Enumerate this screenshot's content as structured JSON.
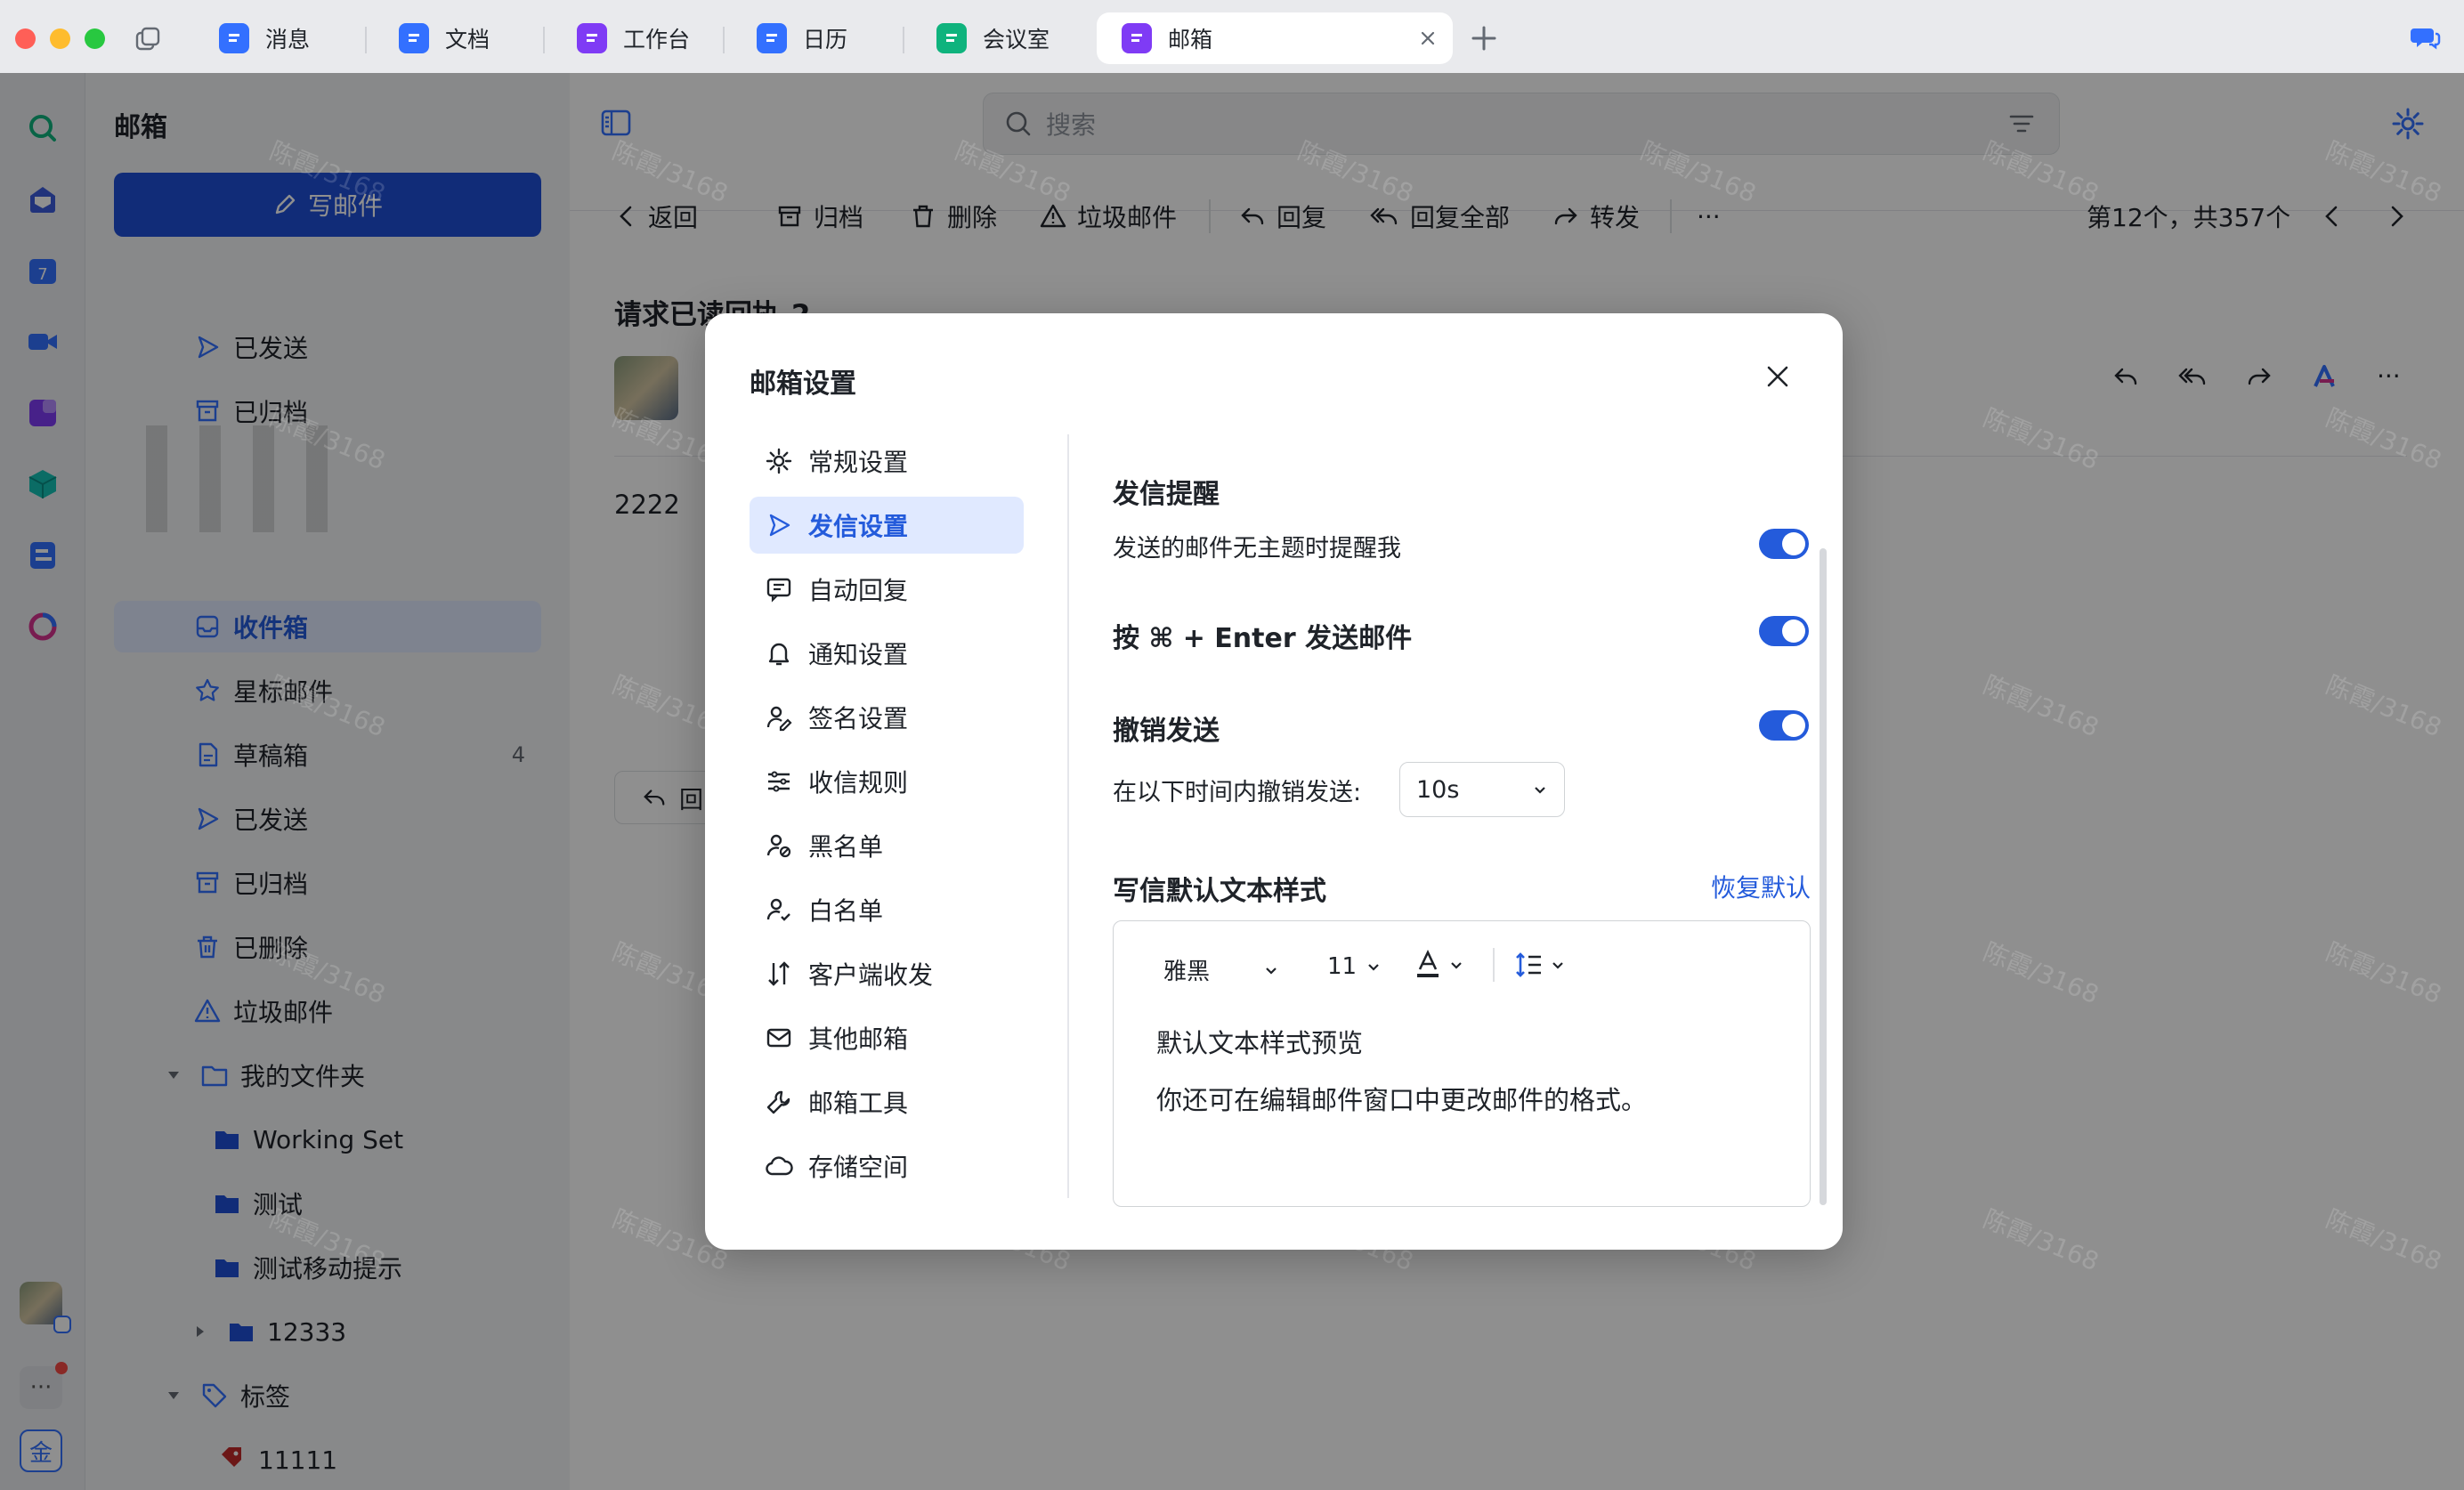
{
  "tabs": [
    {
      "label": "消息",
      "icon": "chat-icon"
    },
    {
      "label": "文档",
      "icon": "doc-icon"
    },
    {
      "label": "工作台",
      "icon": "workbench-icon"
    },
    {
      "label": "日历",
      "icon": "calendar-icon"
    },
    {
      "label": "会议室",
      "icon": "meeting-room-icon"
    },
    {
      "label": "邮箱",
      "icon": "mail-icon"
    }
  ],
  "sidebar": {
    "title": "邮箱",
    "compose": "写邮件",
    "items_a": [
      "已发送",
      "已归档"
    ],
    "items_b": [
      {
        "label": "收件箱",
        "icon": "inbox-icon",
        "active": true
      },
      {
        "label": "星标邮件",
        "icon": "star-icon"
      },
      {
        "label": "草稿箱",
        "icon": "draft-icon",
        "count": "4"
      },
      {
        "label": "已发送",
        "icon": "send-icon"
      },
      {
        "label": "已归档",
        "icon": "archive-icon"
      },
      {
        "label": "已删除",
        "icon": "trash-icon"
      },
      {
        "label": "垃圾邮件",
        "icon": "warning-icon"
      }
    ],
    "folders_title": "我的文件夹",
    "folders": [
      "Working Set",
      "测试",
      "测试移动提示",
      "12333"
    ],
    "tags_title": "标签",
    "tags": [
      "11111"
    ]
  },
  "main": {
    "search_placeholder": "搜索",
    "toolbar": {
      "back": "返回",
      "archive": "归档",
      "delete": "删除",
      "spam": "垃圾邮件",
      "reply": "回复",
      "reply_all": "回复全部",
      "forward": "转发",
      "more": "···",
      "position": "第12个，共357个"
    },
    "subject": "请求已读回执-2",
    "body": "2222",
    "reply_button": "回"
  },
  "watermark": "陈霞/3168",
  "modal": {
    "title": "邮箱设置",
    "nav": [
      {
        "label": "常规设置",
        "icon": "gear-icon"
      },
      {
        "label": "发信设置",
        "icon": "send-icon",
        "active": true
      },
      {
        "label": "自动回复",
        "icon": "auto-reply-icon"
      },
      {
        "label": "通知设置",
        "icon": "bell-icon"
      },
      {
        "label": "签名设置",
        "icon": "signature-icon"
      },
      {
        "label": "收信规则",
        "icon": "rules-icon"
      },
      {
        "label": "黑名单",
        "icon": "blacklist-icon"
      },
      {
        "label": "白名单",
        "icon": "whitelist-icon"
      },
      {
        "label": "客户端收发",
        "icon": "client-icon"
      },
      {
        "label": "其他邮箱",
        "icon": "other-mail-icon"
      },
      {
        "label": "邮箱工具",
        "icon": "tool-icon"
      },
      {
        "label": "存储空间",
        "icon": "cloud-icon"
      }
    ],
    "send_reminder": {
      "title": "发信提醒",
      "option": "发送的邮件无主题时提醒我",
      "on": true
    },
    "shortcut": {
      "title": "按 ⌘ + Enter 发送邮件",
      "on": true
    },
    "undo": {
      "title": "撤销发送",
      "label": "在以下时间内撤销发送:",
      "value": "10s",
      "on": true
    },
    "style": {
      "title": "写信默认文本样式",
      "restore": "恢复默认",
      "font": "雅黑",
      "size": "11",
      "preview_title": "默认文本样式预览",
      "preview_text": "你还可在编辑邮件窗口中更改邮件的格式。"
    }
  },
  "colors": {
    "accent": "#245bdb",
    "compose_bg": "#1f4fd6"
  }
}
